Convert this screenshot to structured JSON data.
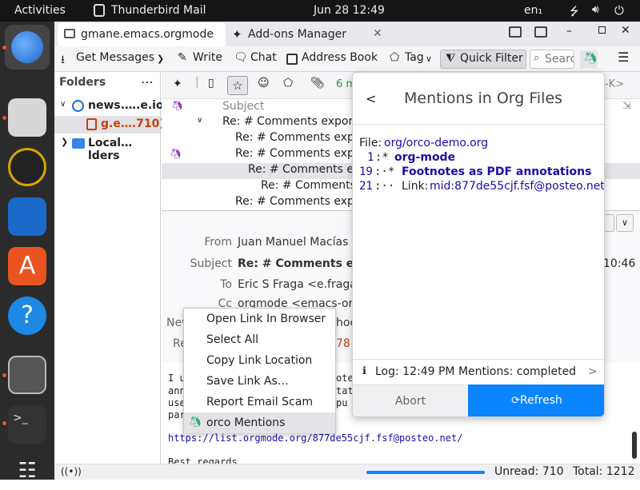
{
  "topbar": {
    "activities": "Activities",
    "app_name": "Thunderbird Mail",
    "datetime": "Jun 28  12:49",
    "lang": "en₁"
  },
  "tabs": [
    {
      "label": "gmane.emacs.orgmode"
    },
    {
      "label": "Add-ons Manager"
    }
  ],
  "toolbar": {
    "get_messages": "Get Messages",
    "write": "Write",
    "chat": "Chat",
    "address_book": "Address Book",
    "tag": "Tag",
    "quick_filter": "Quick Filter",
    "search_placeholder": "Searc"
  },
  "folders": {
    "title": "Folders",
    "items": [
      {
        "label": "news.….e.io"
      },
      {
        "label": "g.e….710)"
      },
      {
        "label": "Local…lders"
      }
    ]
  },
  "threadbar": {
    "count_partial": "6 m",
    "shortcut_partial": "-K>"
  },
  "threads": {
    "subject_header": "Subject",
    "rows": [
      {
        "text": "Re: # Comments export"
      },
      {
        "text": "Re: # Comments expo"
      },
      {
        "text": "Re: # Comments expo"
      },
      {
        "text": "Re: # Comments exp"
      },
      {
        "text": "Re: # Comments e"
      },
      {
        "text": "Re: # Comments expo"
      }
    ]
  },
  "message": {
    "from_label": "From",
    "from_value": "Juan Manuel Macías <",
    "subject_label": "Subject",
    "subject_value": "Re: # Comments expo",
    "to_label": "To",
    "to_value": "Eric S Fraga <e.fraga@",
    "cc_label": "Cc",
    "cc_value": "orgmode <emacs-org",
    "news_label": "New",
    "news_value": "hoc",
    "re_label": "Re",
    "re_value": "78",
    "time": "10:46"
  },
  "body": {
    "lines": [
      "I u",
      "ann",
      "use",
      "par"
    ],
    "frag1": "ote",
    "frag2": "tat",
    "frag3": "pu",
    "link": "https://list.orgmode.org/877de55cjf.fsf@posteo.net/",
    "signoff": "Best regards"
  },
  "context_menu": {
    "items": [
      "Open Link In Browser",
      "Select All",
      "Copy Link Location",
      "Save Link As…",
      "Report Email Scam",
      "orco Mentions"
    ]
  },
  "panel": {
    "back": "<",
    "title": "Mentions in Org Files",
    "file_label": "File: ",
    "file_link": "org/orco-demo.org",
    "entries": [
      {
        "line": "1",
        "prefix": ":* ",
        "text": "org-mode"
      },
      {
        "line": "19",
        "prefix": ":·* ",
        "text": "Footnotes as PDF annotations"
      },
      {
        "line": "21",
        "prefix": ":·· ",
        "label": "Link: ",
        "text": "mid:877de55cjf.fsf@posteo.net"
      }
    ],
    "log": "Log: 12:49 PM Mentions: completed",
    "log_arrow": ">",
    "abort": "Abort",
    "refresh": "Refresh"
  },
  "status": {
    "unread": "Unread: 710",
    "total": "Total: 1212",
    "progress": 1.0
  },
  "colors": {
    "accent": "#0a84ff",
    "ubuntu_orange": "#e95420",
    "folder_selected": "#c7410a"
  }
}
